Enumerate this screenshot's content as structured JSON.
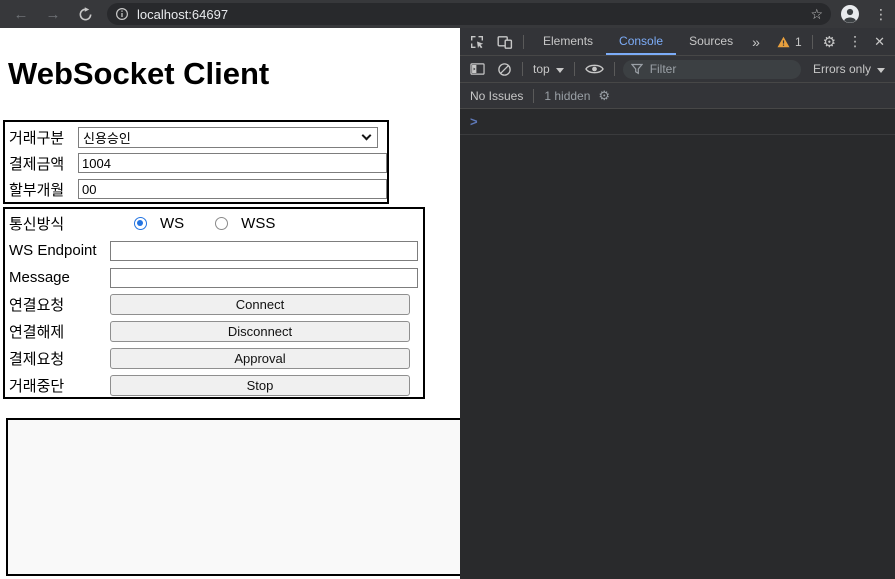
{
  "browser": {
    "url": "localhost:64697"
  },
  "page": {
    "title": "WebSocket Client",
    "transaction": {
      "type_label": "거래구분",
      "type_value": "신용승인",
      "amount_label": "결제금액",
      "amount_value": "1004",
      "installment_label": "할부개월",
      "installment_value": "00"
    },
    "connection": {
      "method_label": "통신방식",
      "ws_label": "WS",
      "wss_label": "WSS",
      "endpoint_label": "WS Endpoint",
      "endpoint_value": "",
      "message_label": "Message",
      "message_value": "",
      "connect_label": "연결요청",
      "connect_button": "Connect",
      "disconnect_label": "연결해제",
      "disconnect_button": "Disconnect",
      "approval_label": "결제요청",
      "approval_button": "Approval",
      "stop_label": "거래중단",
      "stop_button": "Stop"
    }
  },
  "devtools": {
    "tabs": [
      {
        "label": "Elements",
        "selected": false
      },
      {
        "label": "Console",
        "selected": true
      },
      {
        "label": "Sources",
        "selected": false
      }
    ],
    "more_tabs": "»",
    "warning_count": "1",
    "context_selector": "top",
    "filter_placeholder": "Filter",
    "log_level": "Errors only",
    "issues_status": "No Issues",
    "hidden_count": "1 hidden",
    "prompt": ">"
  },
  "colors": {
    "accent_blue": "#7cacf8",
    "warning_orange": "#e8a03e",
    "radio_blue": "#2374e1"
  }
}
